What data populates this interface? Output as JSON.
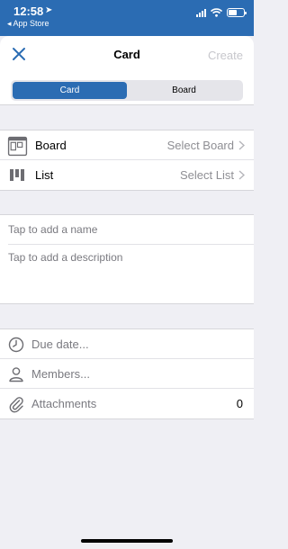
{
  "status": {
    "time": "12:58",
    "back_label": "◂ App Store"
  },
  "nav": {
    "title": "Card",
    "create_label": "Create",
    "close_icon": "close-icon"
  },
  "segments": [
    {
      "label": "Card",
      "active": true
    },
    {
      "label": "Board",
      "active": false
    }
  ],
  "location": {
    "board": {
      "label": "Board",
      "value": "Select Board",
      "icon": "board-icon"
    },
    "list": {
      "label": "List",
      "value": "Select List",
      "icon": "list-icon"
    }
  },
  "details": {
    "name_placeholder": "Tap to add a name",
    "description_placeholder": "Tap to add a description"
  },
  "options": {
    "due_date": {
      "label": "Due date...",
      "icon": "clock-icon"
    },
    "members": {
      "label": "Members...",
      "icon": "person-icon"
    },
    "attachments": {
      "label": "Attachments",
      "count": "0",
      "icon": "paperclip-icon"
    }
  },
  "colors": {
    "accent": "#2b6cb3",
    "background": "#efeff4",
    "disabled": "#c7c7cc"
  }
}
